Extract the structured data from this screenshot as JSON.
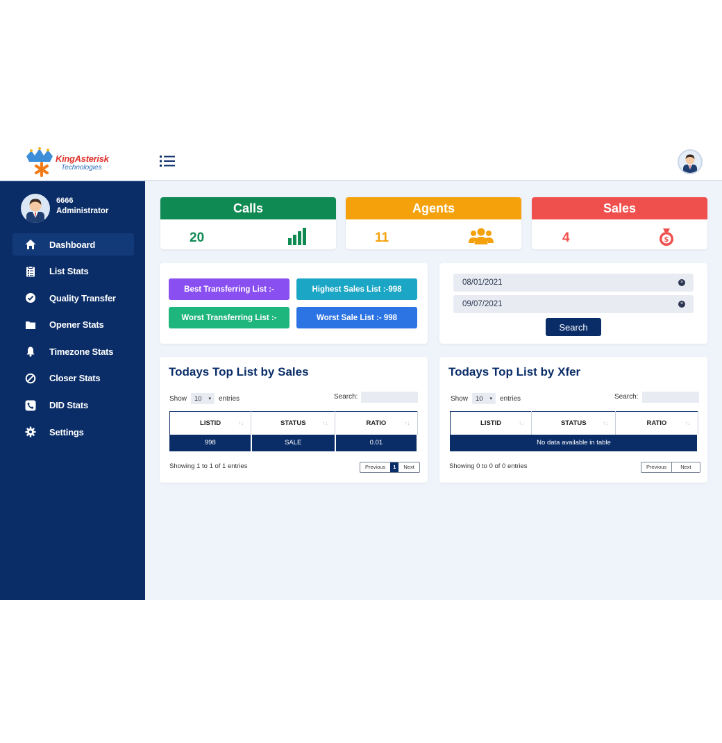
{
  "brand": {
    "name": "KingAsterisk",
    "subtitle": "Technologies"
  },
  "user": {
    "id": "6666",
    "role": "Administrator"
  },
  "sidebar": {
    "items": [
      {
        "label": "Dashboard",
        "icon": "home-icon",
        "active": true
      },
      {
        "label": "List Stats",
        "icon": "clipboard-list-icon"
      },
      {
        "label": "Quality Transfer",
        "icon": "check-circle-icon"
      },
      {
        "label": "Opener Stats",
        "icon": "folder-icon"
      },
      {
        "label": "Timezone Stats",
        "icon": "bell-icon"
      },
      {
        "label": "Closer Stats",
        "icon": "ban-icon"
      },
      {
        "label": "DID Stats",
        "icon": "phone-square-icon"
      },
      {
        "label": "Settings",
        "icon": "gear-icon"
      }
    ]
  },
  "stats": {
    "calls": {
      "label": "Calls",
      "value": "20",
      "color": "#0f8a53",
      "icon": "bar-chart-icon"
    },
    "agents": {
      "label": "Agents",
      "value": "11",
      "color": "#f5a10c",
      "icon": "users-icon"
    },
    "sales": {
      "label": "Sales",
      "value": "4",
      "color": "#f0504d",
      "icon": "money-bag-icon"
    }
  },
  "lists": {
    "best_transferring": "Best Transferring List :-",
    "highest_sales": "Highest Sales List :-998",
    "worst_transferring": "Worst Transferring List :-",
    "worst_sale": "Worst Sale List :- 998"
  },
  "date_filter": {
    "from": "08/01/2021",
    "to": "09/07/2021",
    "search_label": "Search",
    "clear_symbol": "×"
  },
  "table_common": {
    "show": "Show",
    "entries": "entries",
    "page_length": "10",
    "search_label": "Search:",
    "columns": [
      "LISTID",
      "STATUS",
      "RATIO"
    ],
    "previous": "Previous",
    "next": "Next"
  },
  "sales_table": {
    "title": "Todays Top List by Sales",
    "rows": [
      {
        "listid": "998",
        "status": "SALE",
        "ratio": "0.01"
      }
    ],
    "info": "Showing 1 to 1 of 1 entries",
    "current_page": "1"
  },
  "xfer_table": {
    "title": "Todays Top List by Xfer",
    "empty_message": "No data available in table",
    "info": "Showing 0 to 0 of 0 entries"
  }
}
